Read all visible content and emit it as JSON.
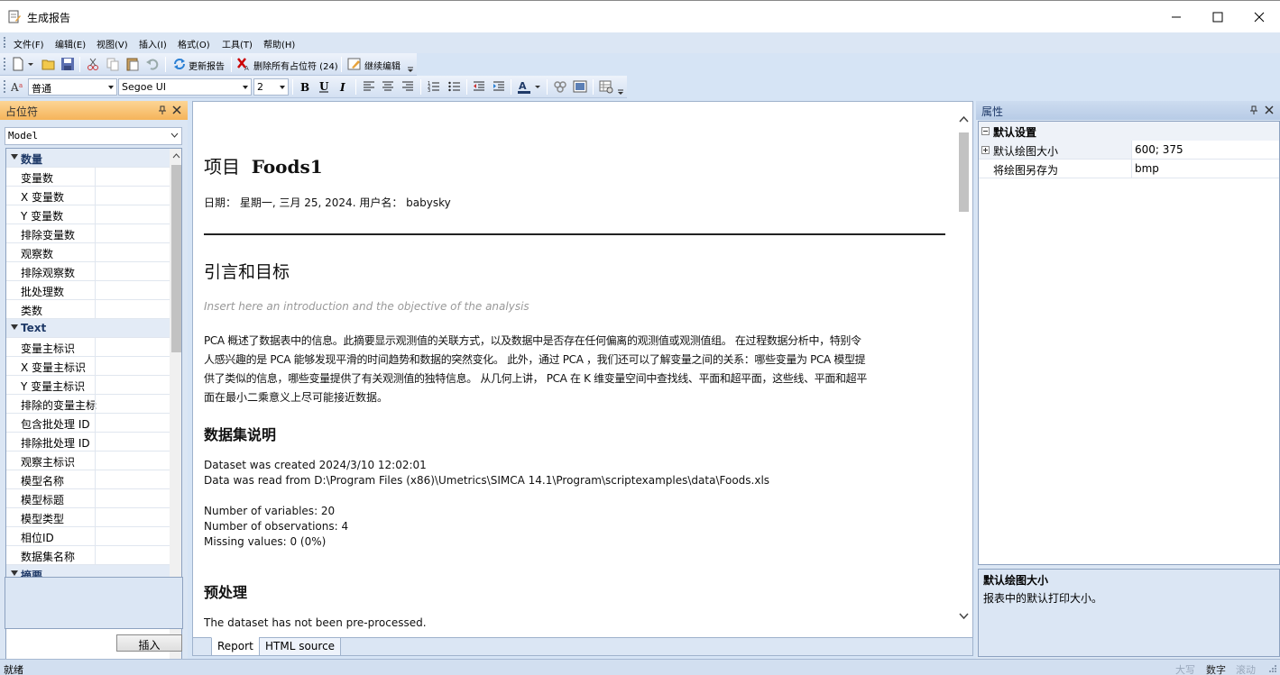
{
  "window": {
    "title": "生成报告"
  },
  "menu": {
    "items": [
      "文件(F)",
      "编辑(E)",
      "视图(V)",
      "插入(I)",
      "格式(O)",
      "工具(T)",
      "帮助(H)"
    ]
  },
  "toolbar1": {
    "refresh_label": "更新报告",
    "delete_label": "删除所有占位符 (24)",
    "continue_label": "继续编辑"
  },
  "toolbar2": {
    "style_value": "普通",
    "font_value": "Segoe UI",
    "size_value": "2"
  },
  "left_panel": {
    "title": "占位符",
    "filter_value": "Model",
    "categories": [
      {
        "name": "数量",
        "items": [
          "变量数",
          "X 变量数",
          "Y 变量数",
          "排除变量数",
          "观察数",
          "排除观察数",
          "批处理数",
          "类数"
        ]
      },
      {
        "name": "Text",
        "items": [
          "变量主标识",
          "X 变量主标识",
          "Y 变量主标识",
          "排除的变量主标",
          "包含批处理 ID",
          "排除批处理 ID",
          "观察主标识",
          "模型名称",
          "模型标题",
          "模型类型",
          "相位ID",
          "数据集名称"
        ]
      },
      {
        "name": "摘要",
        "items": []
      }
    ],
    "insert_label": "插入"
  },
  "document": {
    "project_label": "项目",
    "project_name": "Foods1",
    "date_line": "日期： 星期一, 三月 25, 2024. 用户名： babysky",
    "h_intro": "引言和目标",
    "intro_placeholder": "Insert here an introduction and the objective of the analysis",
    "para_lines": [
      "PCA 概述了数据表中的信息。此摘要显示观测值的关联方式，以及数据中是否存在任何偏离的观测值或观测值组。 在过程数据分析中，特别令",
      "人感兴趣的是 PCA 能够发现平滑的时间趋势和数据的突然变化。 此外，通过 PCA ，我们还可以了解变量之间的关系：哪些变量为 PCA 模型提",
      "供了类似的信息，哪些变量提供了有关观测值的独特信息。 从几何上讲， PCA 在 K 维变量空间中查找线、平面和超平面，这些线、平面和超平",
      "面在最小二乘意义上尽可能接近数据。"
    ],
    "h_dataset": "数据集说明",
    "dataset_lines": [
      "Dataset was created 2024/3/10 12:02:01",
      "Data was read from D:\\Program Files (x86)\\Umetrics\\SIMCA 14.1\\Program\\scriptexamples\\data\\Foods.xls"
    ],
    "stats_lines": [
      "Number of variables: 20",
      "Number of observations: 4",
      "Missing values: 0 (0%)"
    ],
    "h_preprocess": "预处理",
    "preprocess_text": "The dataset has not been pre-processed."
  },
  "tabs": {
    "report": "Report",
    "html": "HTML source"
  },
  "right_panel": {
    "title": "属性",
    "category": "默认设置",
    "rows": [
      {
        "name": "默认绘图大小",
        "value": "600; 375"
      },
      {
        "name": "将绘图另存为",
        "value": "bmp"
      }
    ],
    "desc_title": "默认绘图大小",
    "desc_text": "报表中的默认打印大小。"
  },
  "status": {
    "ready": "就绪",
    "caps": "大写",
    "num": "数字",
    "scroll": "滚动"
  }
}
